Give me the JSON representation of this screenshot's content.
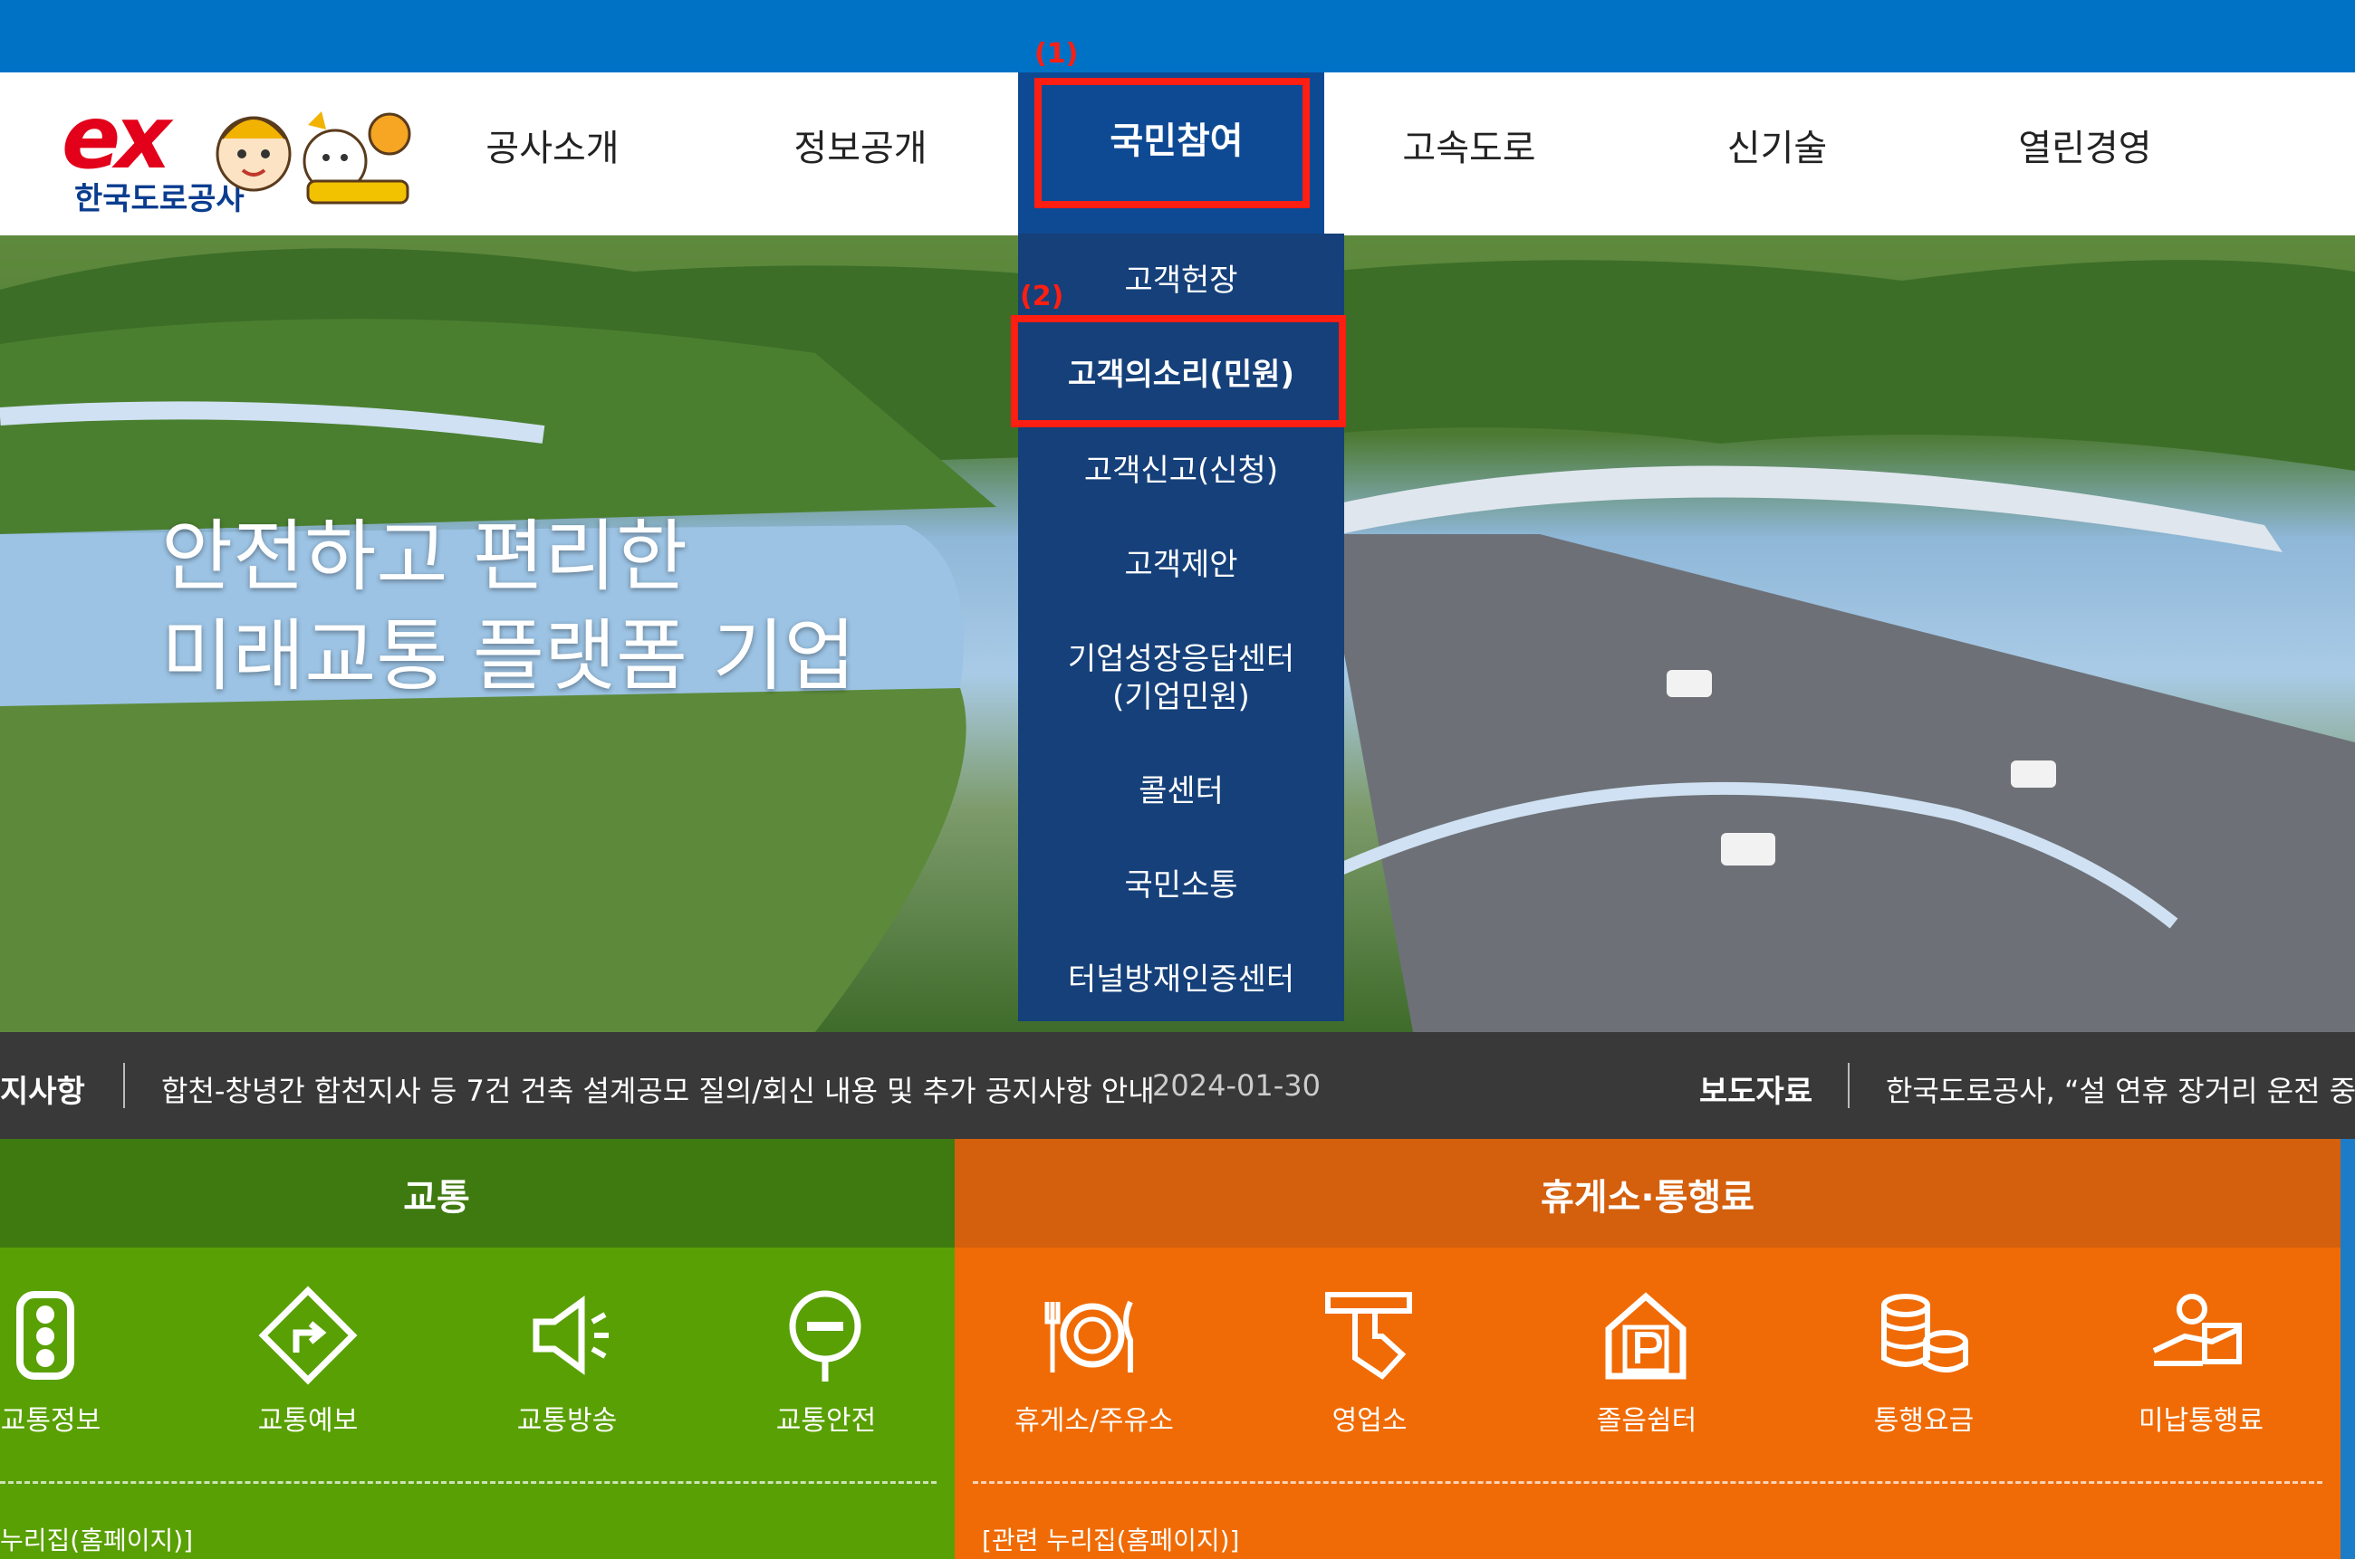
{
  "logo": {
    "ex": "ex",
    "text": "한국도로공사"
  },
  "nav": {
    "items": [
      "공사소개",
      "정보공개",
      "국민참여",
      "고속도로",
      "신기술",
      "열린경영"
    ]
  },
  "dropdown": {
    "items": [
      "고객헌장",
      "고객의소리(민원)",
      "고객신고(신청)",
      "고객제안",
      "기업성장응답센터",
      "(기업민원)",
      "콜센터",
      "국민소통",
      "터널방재인증센터"
    ]
  },
  "markers": {
    "one": "(1)",
    "two": "(2)"
  },
  "hero": {
    "line1": "안전하고 편리한",
    "line2": "미래교통 플랫폼 기업"
  },
  "notice": {
    "label": "지사항",
    "text": "합천-창녕간 합천지사 등 7건 건축 설계공모 질의/회신 내용 및 추가 공지사항 안내",
    "date": "2024-01-30",
    "press_label": "보도자료",
    "press_text": "한국도로공사, “설 연휴 장거리 운전 중"
  },
  "traffic": {
    "title": "교통",
    "items": [
      "교통정보",
      "교통예보",
      "교통방송",
      "교통안전"
    ],
    "related": "누리집(홈페이지)]"
  },
  "rest": {
    "title": "휴게소·통행료",
    "items": [
      "휴게소/주유소",
      "영업소",
      "졸음쉼터",
      "통행요금",
      "미납통행료"
    ],
    "related": "[관련 누리집(홈페이지)]"
  },
  "colors": {
    "topbar": "#0072c6",
    "nav_active": "#0e4a94",
    "dropdown": "#15407a",
    "marker": "#ff1e12",
    "traffic_green": "#59a004",
    "rest_orange": "#f06b05"
  }
}
